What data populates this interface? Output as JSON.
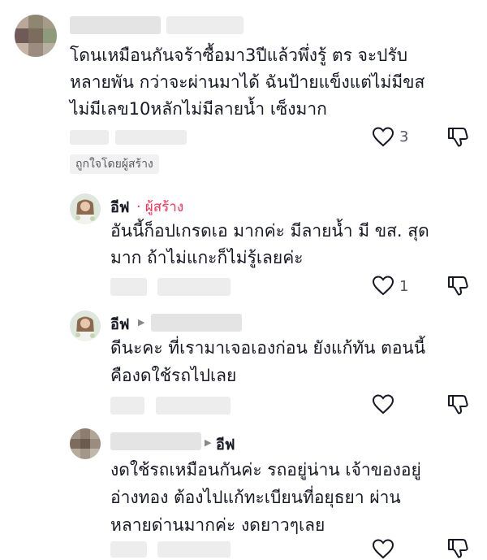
{
  "comments": [
    {
      "text_lines": [
        "โดนเหมือนกันจร้าซื้อมา3ปีแล้วพึ่งรู้ ตร จะปรับ",
        "หลายพัน กว่าจะผ่านมาได้ ฉันป้ายแข็งแต่ไม่มีขส",
        "ไม่มีเลข10หลักไม่มีลายน้ำ เซ็งมาก"
      ],
      "like_count": "3",
      "liked_by_creator": "ถูกใจโดยผู้สร้าง"
    },
    {
      "username": "อีฟ",
      "creator_tag": "· ผู้สร้าง",
      "text_lines": [
        "อันนี้ก็อปเกรดเอ มากค่ะ มีลายน้ำ มี ขส. สุด",
        "มาก ถ้าไม่แกะก็ไม่รู้เลยค่ะ"
      ],
      "like_count": "1"
    },
    {
      "username": "อีฟ",
      "text_lines": [
        "ดีนะคะ ที่เรามาเจอเองก่อน ยังแก้ทัน ตอนนี้",
        "คืองดใช้รถไปเลย"
      ],
      "like_count": ""
    },
    {
      "reply_to": "อีฟ",
      "text_lines": [
        "งดใช้รถเหมือนกันค่ะ รถอยู่น่าน เจ้าของอยู่",
        "อ่างทอง ต้องไปแก้ทะเบียนที่อยุธยา ผ่าน",
        "หลายด่านมากค่ะ งดยาวๆเลย"
      ],
      "like_count": ""
    }
  ],
  "icons": {
    "like": "heart-outline-icon",
    "dislike": "thumbs-down-icon",
    "reply_caret": "caret-right-icon"
  },
  "colors": {
    "text": "#161823",
    "secondary": "#57585e",
    "creator": "#fe2c55",
    "badge_bg": "#f1f1f2"
  }
}
